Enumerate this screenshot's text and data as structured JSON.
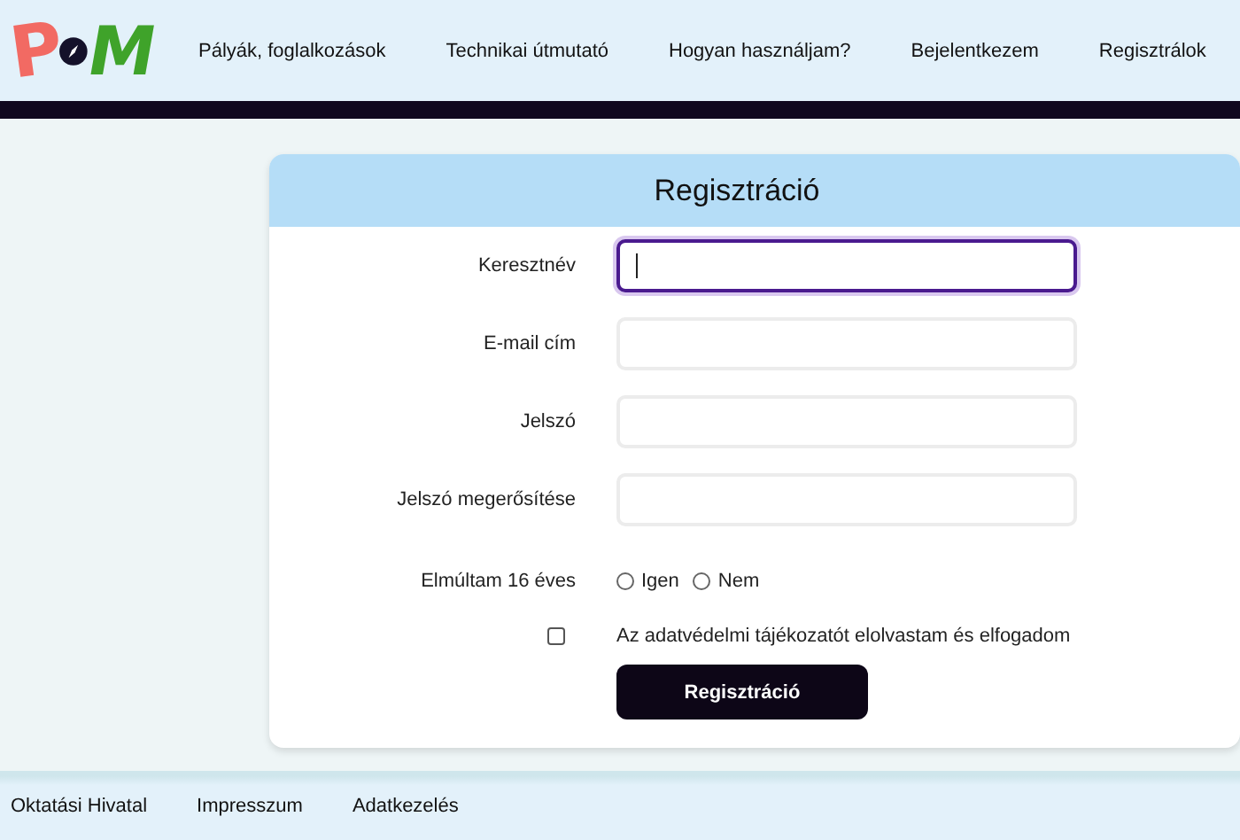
{
  "logo": {
    "left": "P",
    "right": "M"
  },
  "nav": [
    "Pályák, foglalkozások",
    "Technikai útmutató",
    "Hogyan használjam?",
    "Bejelentkezem",
    "Regisztrálok"
  ],
  "form": {
    "title": "Regisztráció",
    "fields": [
      {
        "label": "Keresztnév",
        "focused": true
      },
      {
        "label": "E-mail cím",
        "focused": false
      },
      {
        "label": "Jelszó",
        "focused": false
      },
      {
        "label": "Jelszó megerősítése",
        "focused": false
      }
    ],
    "age": {
      "label": "Elmúltam 16 éves",
      "options": [
        {
          "label": "Igen",
          "selected": false
        },
        {
          "label": "Nem",
          "selected": false
        }
      ]
    },
    "consent": {
      "label": "Az adatvédelmi tájékozatót elolvastam és elfogadom",
      "checked": false
    },
    "submit": "Regisztráció"
  },
  "footer": [
    "Oktatási Hivatal",
    "Impresszum",
    "Adatkezelés"
  ]
}
